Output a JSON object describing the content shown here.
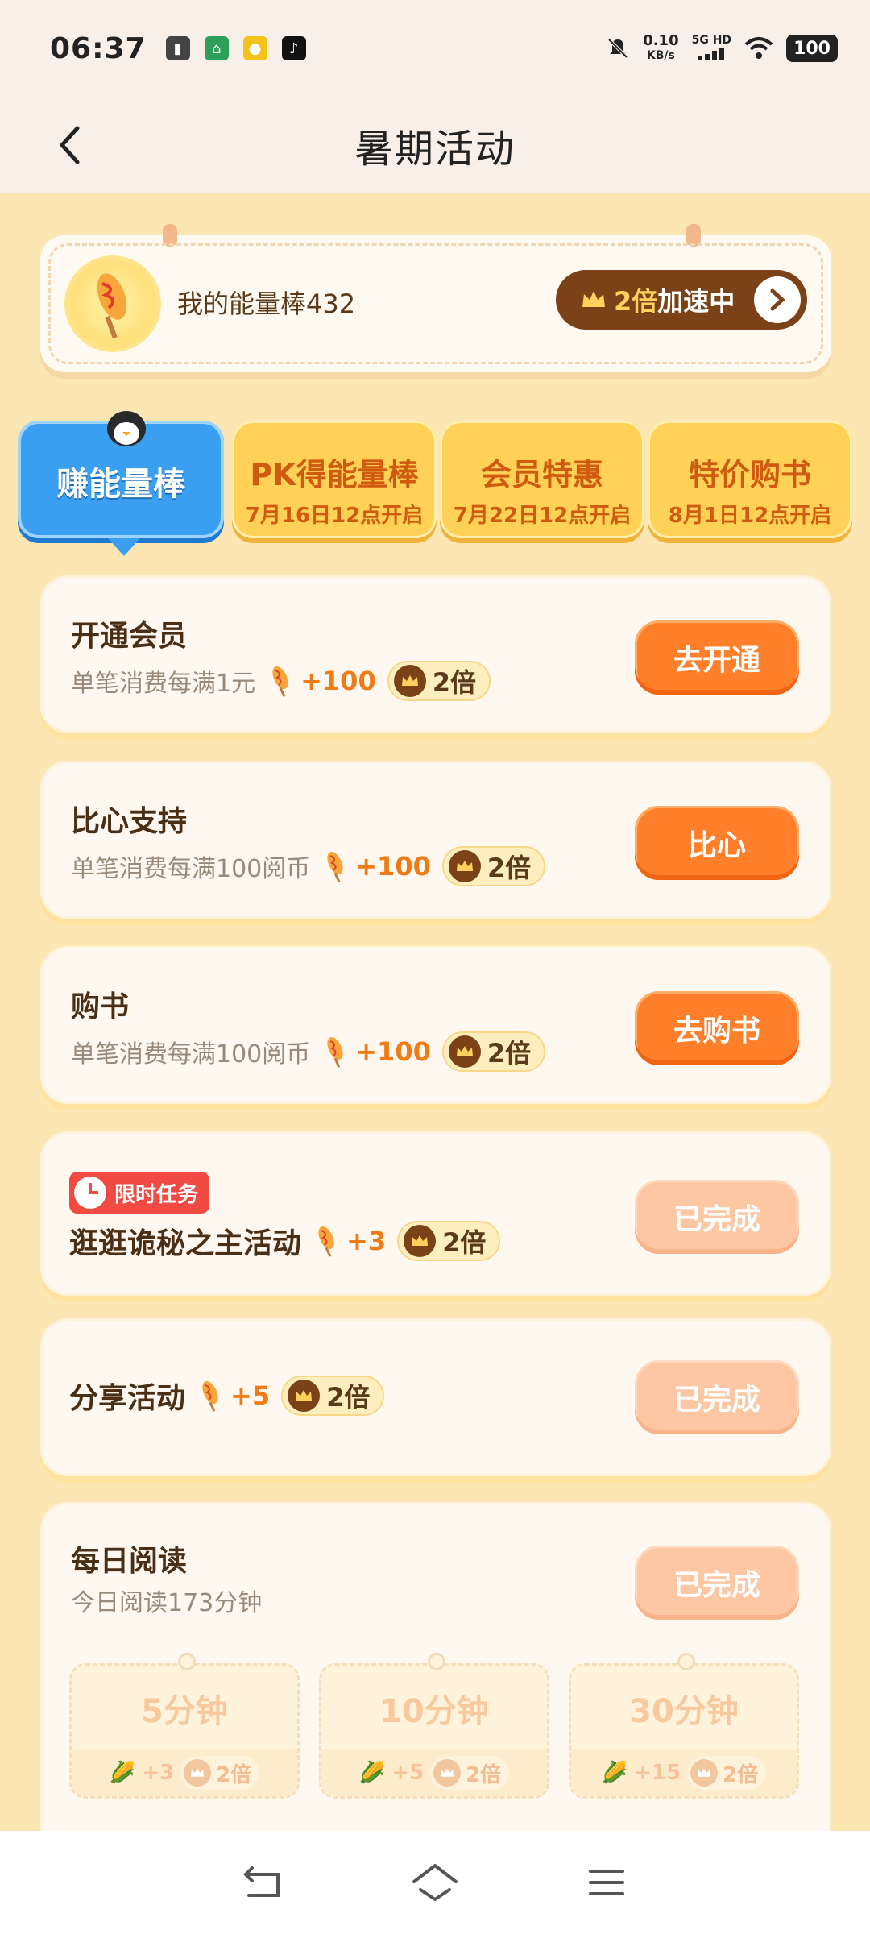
{
  "status_bar": {
    "time": "06:37",
    "net_speed": "0.10",
    "net_unit": "KB/s",
    "net_type": "5G HD",
    "battery": "100"
  },
  "header": {
    "title": "暑期活动"
  },
  "energy": {
    "label": "我的能量棒432",
    "speed_multiplier": "2倍",
    "speed_text": "加速中"
  },
  "tabs": [
    {
      "label": "赚能量棒",
      "sub": ""
    },
    {
      "label": "PK得能量棒",
      "sub": "7月16日12点开启"
    },
    {
      "label": "会员特惠",
      "sub": "7月22日12点开启"
    },
    {
      "label": "特价购书",
      "sub": "8月1日12点开启"
    }
  ],
  "tasks": [
    {
      "title": "开通会员",
      "sub": "单笔消费每满1元",
      "reward": "+100",
      "mult": "2倍",
      "button": "去开通",
      "done": false
    },
    {
      "title": "比心支持",
      "sub": "单笔消费每满100阅币",
      "reward": "+100",
      "mult": "2倍",
      "button": "比心",
      "done": false
    },
    {
      "title": "购书",
      "sub": "单笔消费每满100阅币",
      "reward": "+100",
      "mult": "2倍",
      "button": "去购书",
      "done": false
    },
    {
      "badge": "限时任务",
      "title": "逛逛诡秘之主活动",
      "reward": "+3",
      "mult": "2倍",
      "button": "已完成",
      "done": true
    },
    {
      "title": "分享活动",
      "reward": "+5",
      "mult": "2倍",
      "button": "已完成",
      "done": true
    },
    {
      "title": "每日阅读",
      "sub": "今日阅读173分钟",
      "button": "已完成",
      "done": true
    }
  ],
  "reading_tiles": [
    {
      "minutes": "5分钟",
      "reward": "+3",
      "mult": "2倍"
    },
    {
      "minutes": "10分钟",
      "reward": "+5",
      "mult": "2倍"
    },
    {
      "minutes": "30分钟",
      "reward": "+15",
      "mult": "2倍"
    }
  ],
  "colors": {
    "page_bg": "#fbe6b4",
    "accent_orange": "#ff7f2a",
    "tab_active": "#3a9ff0",
    "tab_inactive": "#ffd257",
    "limited_red": "#f04a42"
  }
}
